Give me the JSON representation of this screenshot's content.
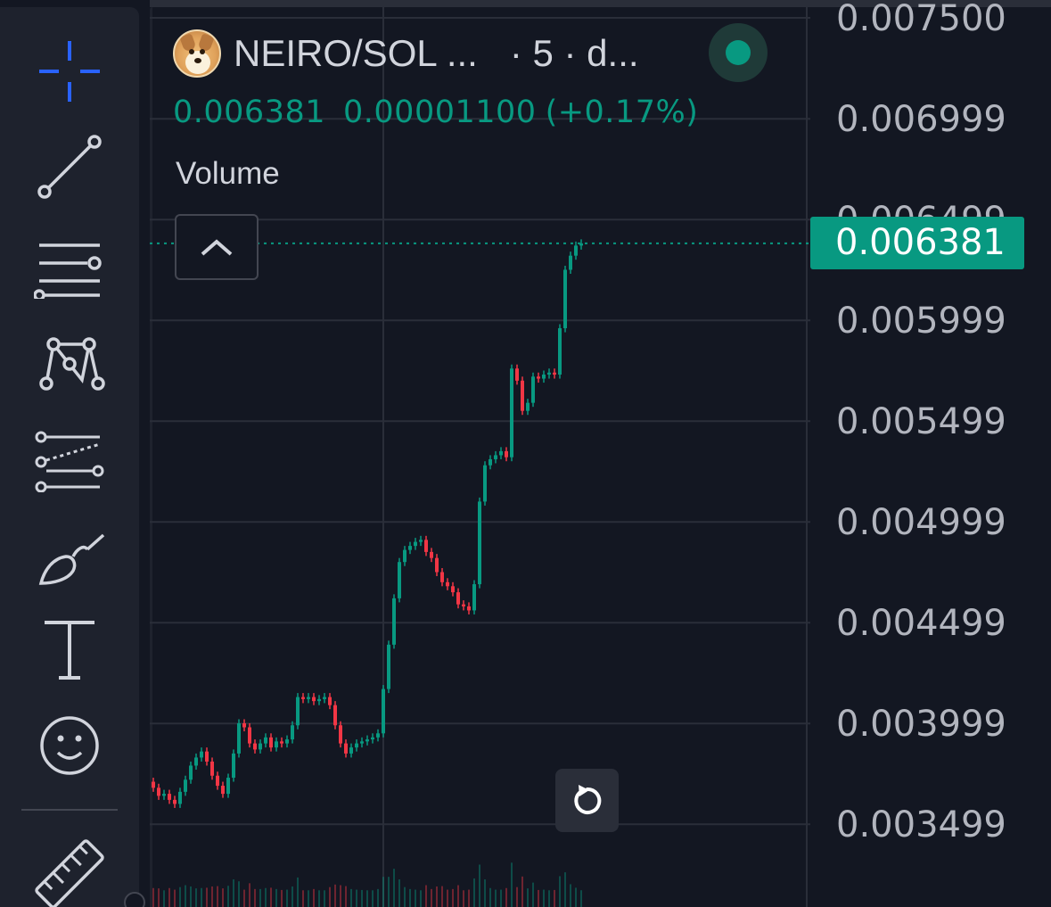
{
  "toolbar": {
    "tools": [
      {
        "name": "crosshair",
        "icon": "crosshair-icon"
      },
      {
        "name": "trend-line",
        "icon": "trend-line-icon"
      },
      {
        "name": "horizontal-lines",
        "icon": "horizontal-lines-icon"
      },
      {
        "name": "pattern",
        "icon": "pattern-icon"
      },
      {
        "name": "fib-channel",
        "icon": "fib-channel-icon"
      },
      {
        "name": "brush",
        "icon": "brush-icon"
      },
      {
        "name": "text",
        "icon": "text-icon"
      },
      {
        "name": "emoji",
        "icon": "smiley-icon"
      },
      {
        "name": "ruler",
        "icon": "ruler-icon"
      }
    ],
    "active_tool_color": "#2962ff"
  },
  "legend": {
    "symbol": "NEIRO/SOL ...",
    "meta": "· 5 · d...",
    "logo_icon": "doge-token-icon",
    "status": "market-open"
  },
  "price": {
    "last": "0.006381",
    "change": "0.00001100",
    "change_pct": "(+0.17%)"
  },
  "indicator": {
    "label": "Volume"
  },
  "axis": {
    "labels": [
      "0.007500",
      "0.006999",
      "0.006499",
      "0.005999",
      "0.005499",
      "0.004999",
      "0.004499",
      "0.003999",
      "0.003499"
    ],
    "last_price_tag": "0.006381"
  },
  "colors": {
    "background": "#131722",
    "up": "#089981",
    "down": "#f23645",
    "text": "#d1d4dc",
    "grid": "#2a2e39"
  },
  "chart_data": {
    "type": "candlestick",
    "interval": "5",
    "ylim": [
      0.0033,
      0.0076
    ],
    "last_price": 0.006381,
    "series": [
      {
        "name": "price",
        "values": [
          0.00368,
          0.00364,
          0.00365,
          0.00362,
          0.0036,
          0.00366,
          0.00372,
          0.00379,
          0.00383,
          0.00386,
          0.00381,
          0.00374,
          0.00369,
          0.00365,
          0.00373,
          0.00385,
          0.004,
          0.00398,
          0.0039,
          0.00387,
          0.0039,
          0.00393,
          0.00388,
          0.00391,
          0.0039,
          0.00392,
          0.00399,
          0.00413,
          0.00412,
          0.00413,
          0.00411,
          0.00412,
          0.00413,
          0.00409,
          0.00399,
          0.0039,
          0.00385,
          0.00388,
          0.0039,
          0.00391,
          0.00392,
          0.00393,
          0.00395,
          0.00417,
          0.00439,
          0.00462,
          0.0048,
          0.00486,
          0.00488,
          0.0049,
          0.00491,
          0.00485,
          0.00482,
          0.00475,
          0.0047,
          0.00468,
          0.00465,
          0.00459,
          0.00458,
          0.00456,
          0.00469,
          0.0051,
          0.00528,
          0.00531,
          0.00533,
          0.00535,
          0.00532,
          0.00576,
          0.0057,
          0.00555,
          0.00559,
          0.00572,
          0.00571,
          0.00573,
          0.00574,
          0.00573,
          0.00596,
          0.00625,
          0.00632,
          0.00637,
          0.006381
        ]
      }
    ]
  }
}
